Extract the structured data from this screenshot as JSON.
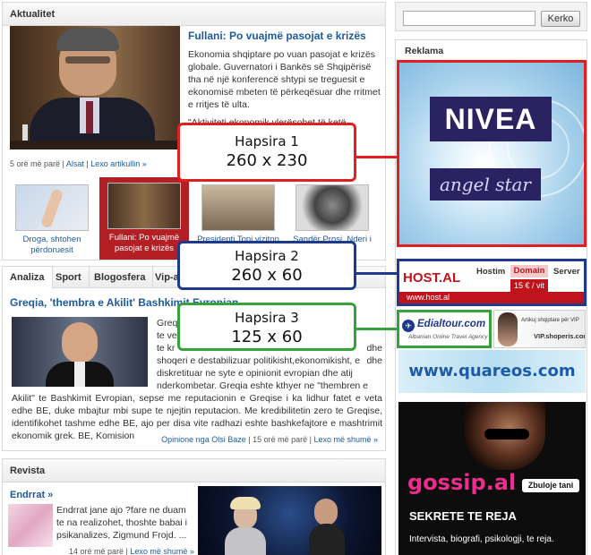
{
  "aktualitet": {
    "header": "Aktualitet",
    "headline": "Fullani: Po vuajmë pasojat e krizës",
    "body": "Ekonomia shqiptare po vuan pasojat e krizës globale. Guvernatori i Bankës së Shqipërisë tha në një konferencë shtypi se treguesit e ekonomisë mbeten të përkeqësuar dhe rritmet e rritjes të ulta.",
    "quote": "\"Aktiviteti ekonomik vlerësohet të ketë regjistruar ... gjatë 6",
    "time": "5 orë më parë",
    "source": "Alsat",
    "read_more": "Lexo artikullin »",
    "thumbs": [
      "Droga, shtohen përdoruesit",
      "Fullani: Po vuajmë pasojat e krizës",
      "Presidenti Topi viziton",
      "Sandër Prosi, Nderi i"
    ]
  },
  "tabs": [
    "Analiza",
    "Sport",
    "Blogosfera",
    "Vip-at"
  ],
  "analiza": {
    "headline": "Greqia, 'thembra e Akilit' Bashkimit Evropian",
    "body_right": [
      "Greqi",
      "te ve",
      "te kr",
      "shoqeri e destabilizuar politikisht,ekonomikisht, e",
      "diskretituar ne syte e opinionit evropian dhe atij",
      "nderkombetar. Greqia eshte kthyer ne \"thembren e"
    ],
    "body_right_tail": [
      "dhe",
      "dhe"
    ],
    "body_full": "Akilit\" te Bashkimit Evropian, sepse me reputacionin e Greqise i ka lidhur fatet e veta edhe BE, duke mbajtur mbi supe te njejtin reputacion. Me kredibilitetin zero te Greqise, identifikohet tashme edhe BE, ajo per disa vite radhazi eshte bashkefajtore e mashtrimit ekonomik grek. BE, Komision",
    "opinion": "Opinione nga Olsi Baze",
    "time": "15 orë më parë",
    "read_more": "Lexo më shumë »"
  },
  "revista": {
    "header": "Revista",
    "title": "Endrrat »",
    "body": "Endrrat jane ajo ?fare ne duam te na realizohet, thoshte babai i psikanalizes, Zigmund Frojd. ...",
    "time": "14 orë më parë",
    "read_more": "Lexo më shumë »"
  },
  "search": {
    "placeholder": "",
    "button": "Kerko"
  },
  "reklama": {
    "header": "Reklama",
    "nivea_brand": "NIVEA",
    "nivea_sub": "angel star",
    "host_brand": "HOST.AL",
    "host_cols": [
      "Hostim",
      "Domain",
      "Server"
    ],
    "host_price": "15 € / vit",
    "host_url": "www.host.al",
    "edial_brand": "Edialtour.com",
    "edial_sub": "Albanian Online Travel Agency",
    "vip_text": "Artikuj shqiptare për VIP",
    "vip_url": "VIP.shoperis.com",
    "quareos": "www.quareos.com",
    "gossip_brand": "gossip.al",
    "gossip_btn": "Zbuloje tani",
    "gossip_tag": "SEKRETE TE REJA",
    "gossip_sub": "Intervista, biografi, psikologji, te reja."
  },
  "callouts": [
    {
      "title": "Hapsira 1",
      "size": "260 x 230",
      "color": "#e02020"
    },
    {
      "title": "Hapsira 2",
      "size": "260 x 60",
      "color": "#1f3a8a"
    },
    {
      "title": "Hapsira 3",
      "size": "125 x 60",
      "color": "#35a33a"
    }
  ]
}
